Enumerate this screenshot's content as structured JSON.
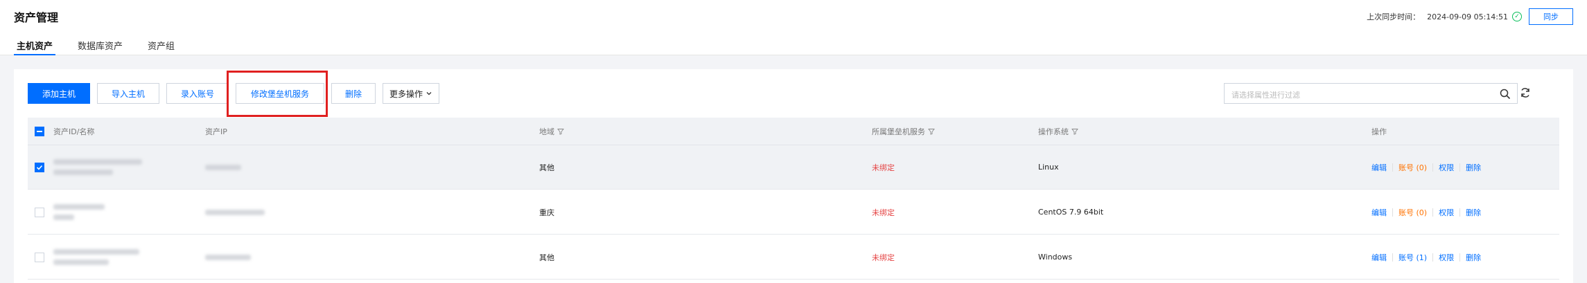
{
  "header": {
    "title": "资产管理",
    "tabs": [
      {
        "label": "主机资产",
        "active": true
      },
      {
        "label": "数据库资产",
        "active": false
      },
      {
        "label": "资产组",
        "active": false
      }
    ],
    "sync": {
      "label": "上次同步时间：",
      "time": "2024-09-09 05:14:51",
      "button": "同步"
    }
  },
  "toolbar": {
    "add_host": "添加主机",
    "import_host": "导入主机",
    "enter_account": "录入账号",
    "modify_bastion": "修改堡垒机服务",
    "delete": "删除",
    "more": "更多操作"
  },
  "search": {
    "placeholder": "请选择属性进行过滤"
  },
  "table": {
    "columns": {
      "id_name": "资产ID/名称",
      "ip": "资产IP",
      "region": "地域",
      "bastion": "所属堡垒机服务",
      "os": "操作系统",
      "actions": "操作"
    },
    "rows": [
      {
        "checked": true,
        "region": "其他",
        "bastion": "未绑定",
        "os": "Linux",
        "edit": "编辑",
        "account": "账号",
        "account_count": "(0)",
        "permission": "权限",
        "delete": "删除"
      },
      {
        "checked": false,
        "region": "重庆",
        "bastion": "未绑定",
        "os": "CentOS 7.9 64bit",
        "edit": "编辑",
        "account": "账号",
        "account_count": "(0)",
        "permission": "权限",
        "delete": "删除"
      },
      {
        "checked": false,
        "region": "其他",
        "bastion": "未绑定",
        "os": "Windows",
        "edit": "编辑",
        "account": "账号",
        "account_count": "(1)",
        "permission": "权限",
        "delete": "删除"
      }
    ]
  },
  "colors": {
    "primary": "#006eff",
    "warning": "#ff7200",
    "danger": "#e54545",
    "success": "#0abf5b",
    "highlight": "#e02020"
  }
}
